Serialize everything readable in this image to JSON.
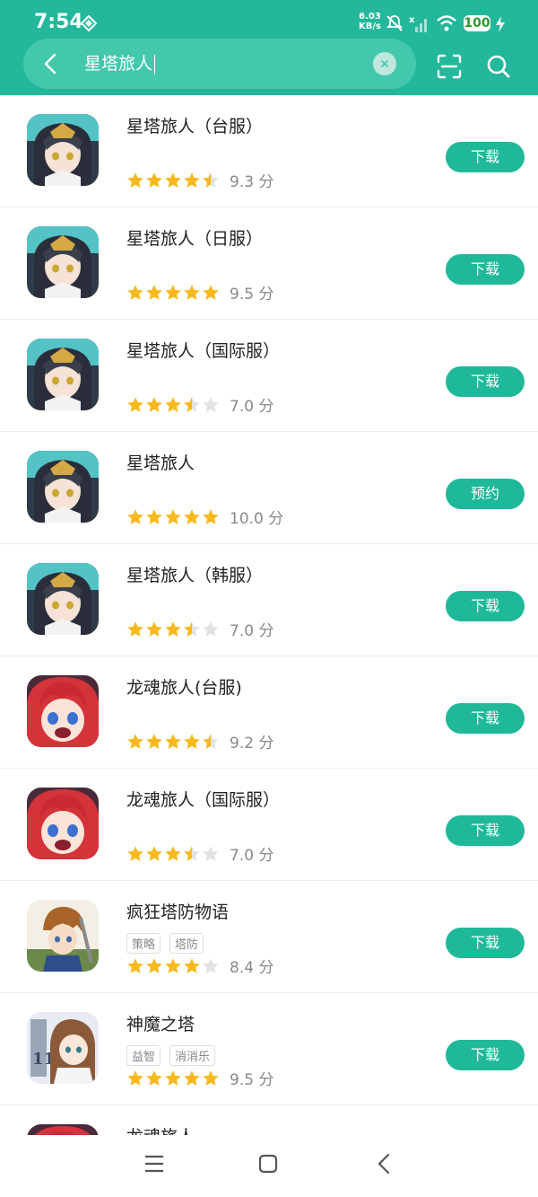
{
  "status": {
    "time": "7:54",
    "net_speed_value": "6.03",
    "net_speed_unit": "KB/s",
    "battery": "100"
  },
  "search": {
    "query": "星塔旅人"
  },
  "results": [
    {
      "title": "星塔旅人（台服）",
      "tags": [],
      "rating": 4.5,
      "score": "9.3 分",
      "button": "下载",
      "icon": "girl-helmet"
    },
    {
      "title": "星塔旅人（日服）",
      "tags": [],
      "rating": 5,
      "score": "9.5 分",
      "button": "下载",
      "icon": "girl-helmet"
    },
    {
      "title": "星塔旅人（国际服）",
      "tags": [],
      "rating": 3.5,
      "score": "7.0 分",
      "button": "下载",
      "icon": "girl-helmet"
    },
    {
      "title": "星塔旅人",
      "tags": [],
      "rating": 5,
      "score": "10.0 分",
      "button": "预约",
      "icon": "girl-helmet"
    },
    {
      "title": "星塔旅人（韩服）",
      "tags": [],
      "rating": 3.5,
      "score": "7.0 分",
      "button": "下载",
      "icon": "girl-helmet"
    },
    {
      "title": "龙魂旅人(台服)",
      "tags": [],
      "rating": 4.5,
      "score": "9.2 分",
      "button": "下载",
      "icon": "red-hair-girl"
    },
    {
      "title": "龙魂旅人（国际服）",
      "tags": [],
      "rating": 3.5,
      "score": "7.0 分",
      "button": "下载",
      "icon": "red-hair-girl"
    },
    {
      "title": "疯狂塔防物语",
      "tags": [
        "策略",
        "塔防"
      ],
      "rating": 4,
      "score": "8.4 分",
      "button": "下载",
      "icon": "brown-hair-boy"
    },
    {
      "title": "神魔之塔",
      "tags": [
        "益智",
        "消消乐"
      ],
      "rating": 5,
      "score": "9.5 分",
      "button": "下载",
      "icon": "brown-hair-girl"
    },
    {
      "title": "龙魂旅人",
      "tags": [],
      "rating": 0,
      "score": "",
      "button": "",
      "icon": "red-hair-girl"
    }
  ],
  "colors": {
    "header": "#23b79b",
    "button": "#1fb999",
    "star": "#f7b91e",
    "star_empty": "#e2e2e2"
  }
}
